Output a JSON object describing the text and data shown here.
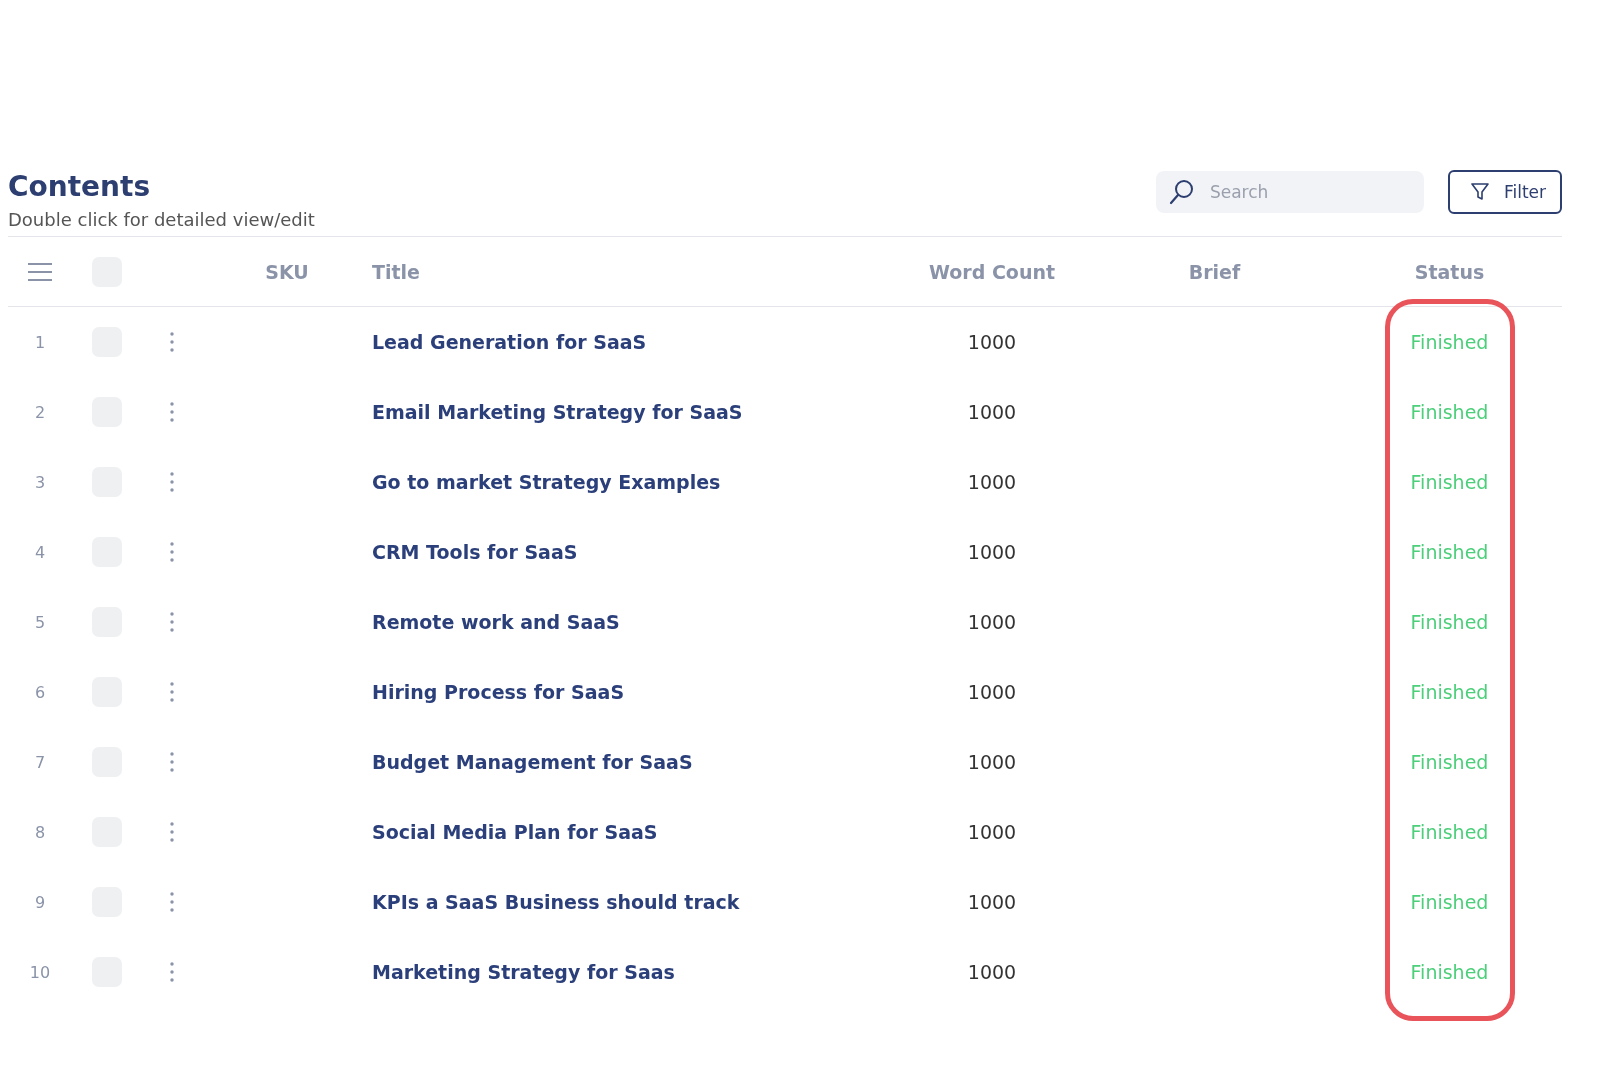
{
  "header": {
    "title": "Contents",
    "subtitle": "Double click for detailed view/edit"
  },
  "search": {
    "placeholder": "Search"
  },
  "filter_button": {
    "label": "Filter"
  },
  "table": {
    "select_all": {
      "checked": false
    },
    "columns": [
      {
        "label": "SKU",
        "highlighted": false
      },
      {
        "label": "Title",
        "highlighted": false
      },
      {
        "label": "Word Count",
        "highlighted": false
      },
      {
        "label": "Brief",
        "highlighted": false
      },
      {
        "label": "Status",
        "highlighted": true
      }
    ],
    "rows": [
      {
        "number": "1",
        "checked": false,
        "title": "Lead Generation for SaaS",
        "word_count": "1000",
        "status": "Finished"
      },
      {
        "number": "2",
        "checked": false,
        "title": "Email Marketing Strategy for SaaS",
        "word_count": "1000",
        "status": "Finished"
      },
      {
        "number": "3",
        "checked": false,
        "title": "Go to market Strategy Examples",
        "word_count": "1000",
        "status": "Finished"
      },
      {
        "number": "4",
        "checked": false,
        "title": "CRM Tools for SaaS",
        "word_count": "1000",
        "status": "Finished"
      },
      {
        "number": "5",
        "checked": false,
        "title": "Remote work and SaaS",
        "word_count": "1000",
        "status": "Finished"
      },
      {
        "number": "6",
        "checked": false,
        "title": "Hiring Process for SaaS",
        "word_count": "1000",
        "status": "Finished"
      },
      {
        "number": "7",
        "checked": false,
        "title": "Budget Management for SaaS",
        "word_count": "1000",
        "status": "Finished"
      },
      {
        "number": "8",
        "checked": false,
        "title": "Social Media Plan for SaaS",
        "word_count": "1000",
        "status": "Finished"
      },
      {
        "number": "9",
        "checked": false,
        "title": "KPIs a SaaS Business should track",
        "word_count": "1000",
        "status": "Finished"
      },
      {
        "number": "10",
        "checked": false,
        "title": "Marketing Strategy for Saas",
        "word_count": "1000",
        "status": "Finished"
      }
    ]
  }
}
